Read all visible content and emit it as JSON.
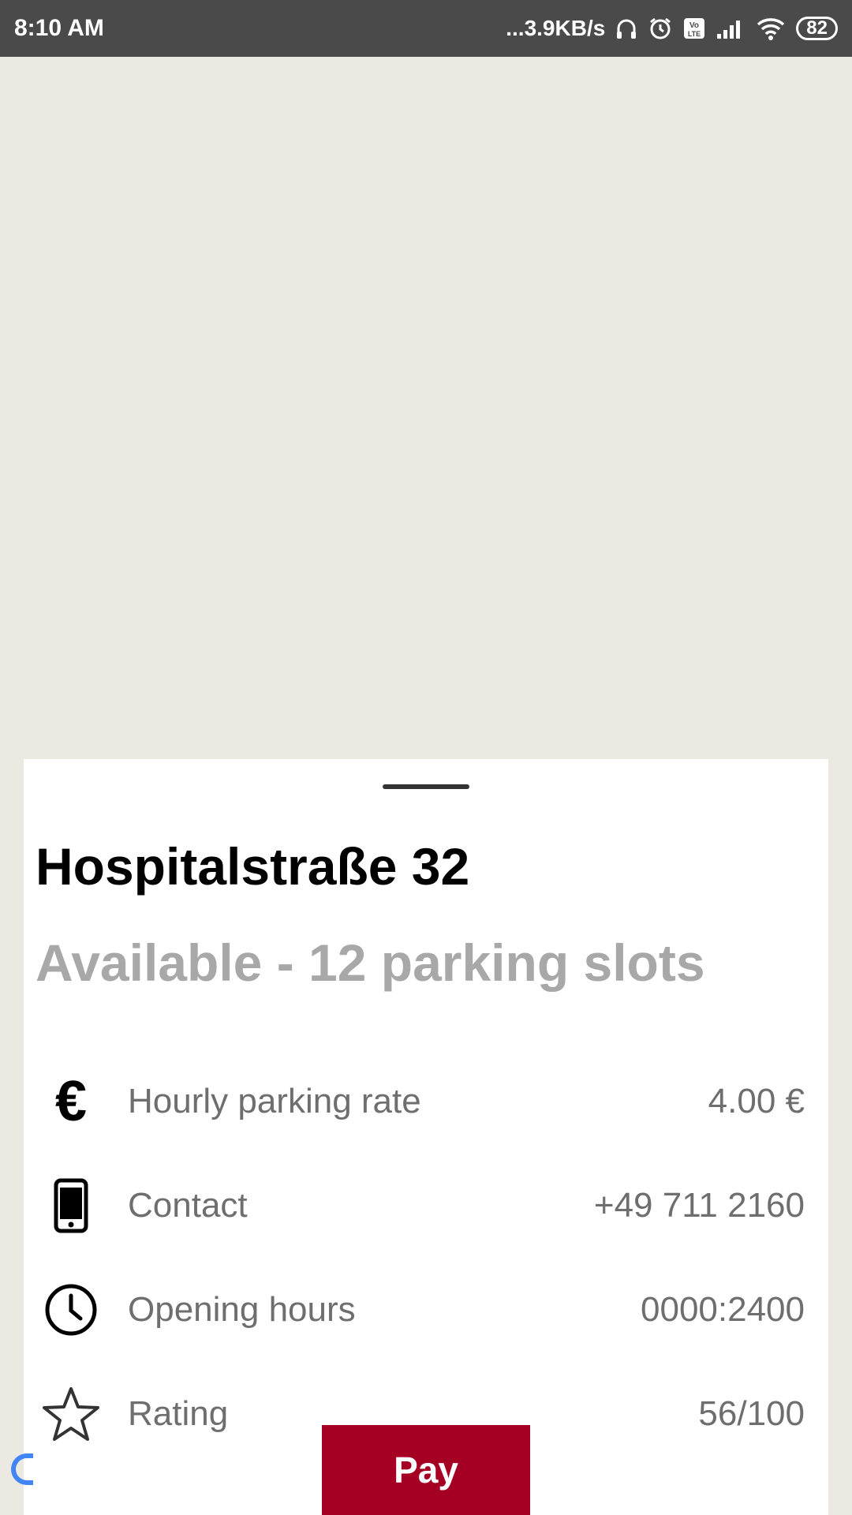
{
  "status_bar": {
    "time": "8:10 AM",
    "network_speed": "...3.9KB/s",
    "battery_level": "82",
    "icons": [
      "headphones-icon",
      "alarm-icon",
      "volte-icon",
      "signal-icon",
      "wifi-icon",
      "battery-icon"
    ]
  },
  "sheet": {
    "title": "Hospitalstraße 32",
    "subtitle": "Available - 12 parking slots",
    "rows": [
      {
        "icon": "euro-icon",
        "label": "Hourly parking rate",
        "value": "4.00 €"
      },
      {
        "icon": "phone-icon",
        "label": "Contact",
        "value": "+49 711 2160"
      },
      {
        "icon": "clock-icon",
        "label": "Opening hours",
        "value": "0000:2400"
      },
      {
        "icon": "star-icon",
        "label": "Rating",
        "value": "56/100"
      }
    ],
    "pay_label": "Pay"
  },
  "colors": {
    "status_bar": "#4A4A4A",
    "map_background": "#ECE9E3",
    "subtitle": "#A8A8A8",
    "pay_button": "#A50023"
  }
}
